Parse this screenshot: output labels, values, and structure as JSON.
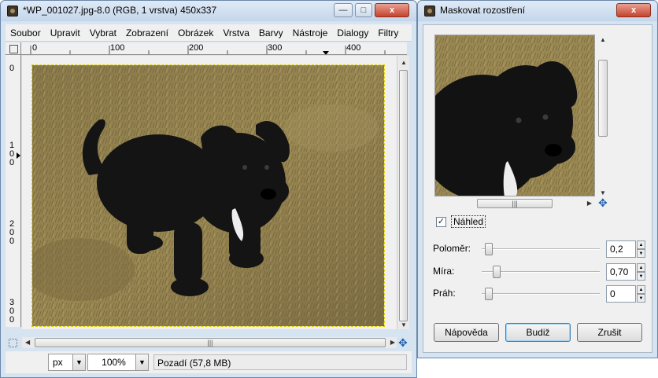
{
  "main_window": {
    "title": "*WP_001027.jpg-8.0 (RGB, 1 vrstva) 450x337",
    "caption_buttons": {
      "minimize": "—",
      "maximize": "□",
      "close": "x"
    },
    "menu": [
      {
        "label": "Soubor"
      },
      {
        "label": "Upravit"
      },
      {
        "label": "Vybrat"
      },
      {
        "label": "Zobrazení"
      },
      {
        "label": "Obrázek"
      },
      {
        "label": "Vrstva"
      },
      {
        "label": "Barvy"
      },
      {
        "label": "Nástroje"
      },
      {
        "label": "Dialogy"
      },
      {
        "label": "Filtry"
      }
    ],
    "ruler_h_ticks": [
      "0",
      "100",
      "200",
      "300",
      "400"
    ],
    "ruler_v_ticks": [
      "0",
      "1\n0\n0",
      "2\n0\n0",
      "3\n0\n0"
    ],
    "status": {
      "unit": "px",
      "zoom": "100%",
      "layer_info": "Pozadí (57,8 MB)"
    }
  },
  "dialog": {
    "title": "Maskovat rozostření",
    "close_button": "x",
    "preview_checkbox": {
      "label": "Náhled",
      "checked": true
    },
    "params": [
      {
        "label": "Poloměr:",
        "value": "0,2",
        "fraction": 0.0
      },
      {
        "label": "Míra:",
        "value": "0,70",
        "fraction": 0.07
      },
      {
        "label": "Práh:",
        "value": "0",
        "fraction": 0.0
      }
    ],
    "buttons": {
      "help": "Nápověda",
      "ok": "Budiž",
      "cancel": "Zrušit"
    }
  }
}
